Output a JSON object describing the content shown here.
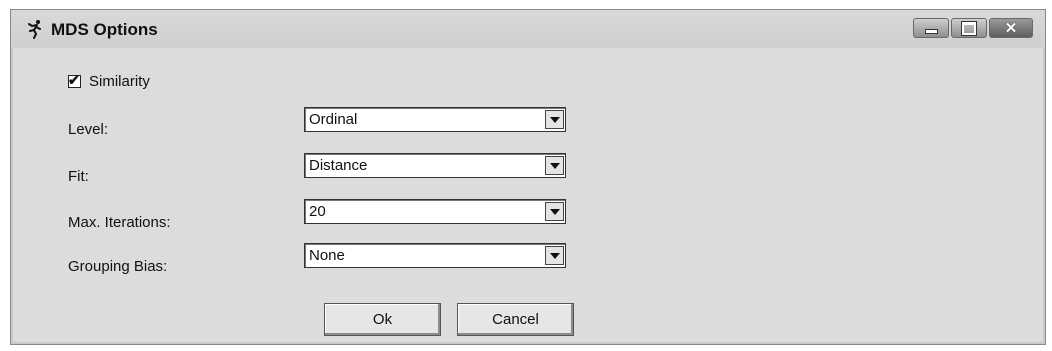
{
  "window": {
    "title": "MDS Options",
    "app_icon": "running-figure-icon",
    "controls": {
      "minimize": "minimize-icon",
      "maximize": "maximize-icon",
      "close": "close-icon"
    }
  },
  "similarity": {
    "label": "Similarity",
    "checked": true,
    "check_glyph": "✔"
  },
  "fields": {
    "level": {
      "label": "Level:",
      "value": "Ordinal"
    },
    "fit": {
      "label": "Fit:",
      "value": "Distance"
    },
    "max_iterations": {
      "label": "Max. Iterations:",
      "value": "20"
    },
    "grouping_bias": {
      "label": "Grouping Bias:",
      "value": "None"
    }
  },
  "buttons": {
    "ok": "Ok",
    "cancel": "Cancel"
  }
}
